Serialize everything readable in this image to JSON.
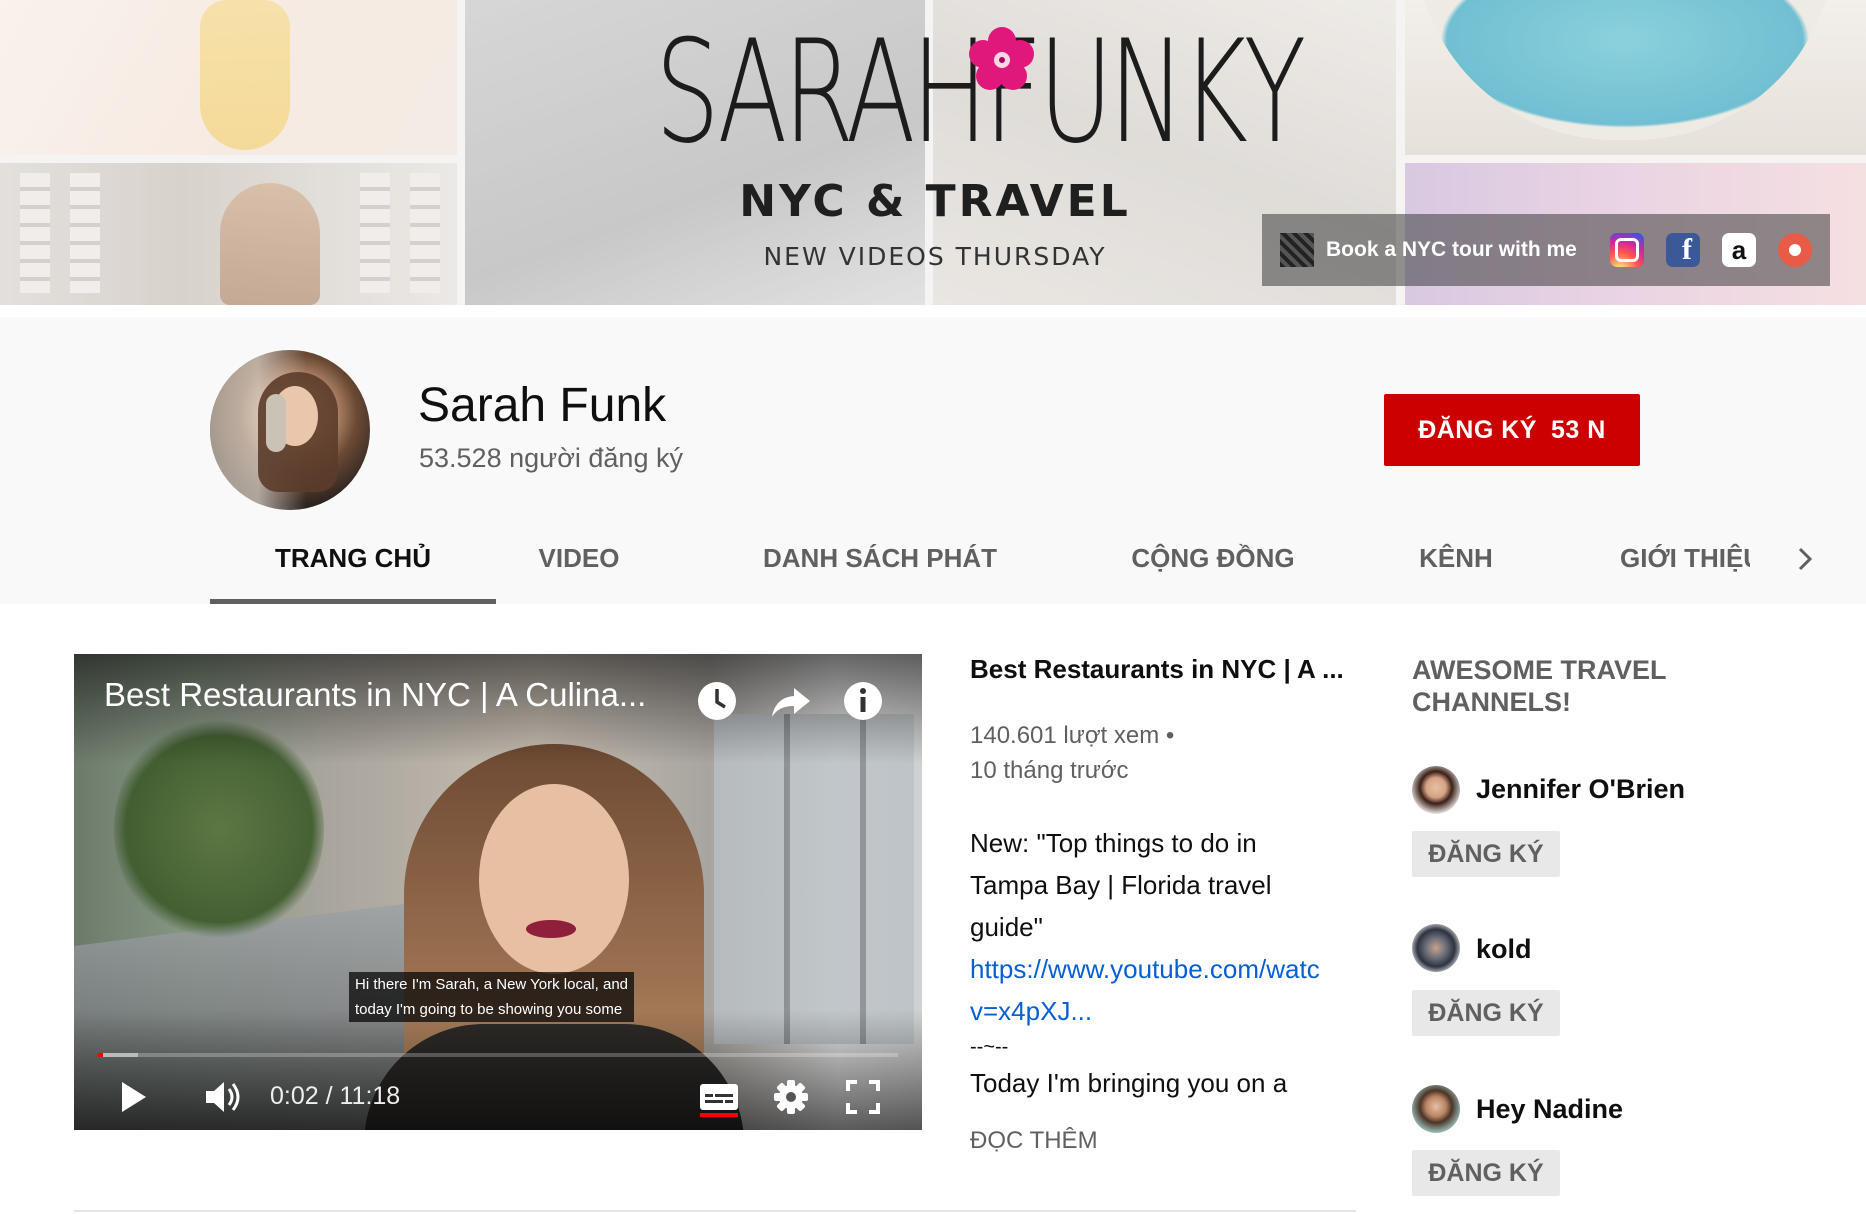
{
  "banner": {
    "logo_title": "SARAHFUNKY",
    "logo_subtitle": "NYC & TRAVEL",
    "logo_tagline": "NEW VIDEOS THURSDAY",
    "links": {
      "primary_label": "Book a NYC tour with me",
      "icons": [
        "instagram-icon",
        "facebook-icon",
        "amazon-icon",
        "patreon-icon"
      ]
    }
  },
  "channel": {
    "name": "Sarah Funk",
    "subscribers": "53.528 người đăng ký",
    "subscribe_label": "ĐĂNG KÝ",
    "subscribe_count": "53 N"
  },
  "tabs": {
    "items": [
      {
        "label": "TRANG CHỦ",
        "active": true
      },
      {
        "label": "VIDEO",
        "active": false
      },
      {
        "label": "DANH SÁCH PHÁT",
        "active": false
      },
      {
        "label": "CỘNG ĐỒNG",
        "active": false
      },
      {
        "label": "KÊNH",
        "active": false
      },
      {
        "label": "GIỚI THIỆU",
        "active": false
      }
    ],
    "next_icon": "chevron-right-icon"
  },
  "player": {
    "title": "Best Restaurants in NYC | A Culina...",
    "caption_line1": "Hi there I'm Sarah, a New York local, and",
    "caption_line2": "today I'm going to be showing you some",
    "time": "0:02 / 11:18",
    "progress_played_fraction": 0.003,
    "progress_loaded_fraction": 0.05,
    "overlay_icons": [
      "watch-later-icon",
      "share-icon",
      "info-icon"
    ],
    "control_icons": [
      "play-icon",
      "volume-icon",
      "captions-icon",
      "settings-icon",
      "fullscreen-icon"
    ]
  },
  "video_info": {
    "title": "Best Restaurants in NYC | A ...",
    "views": "140.601 lượt xem •",
    "age": "10 tháng trước",
    "desc_line1": "New: \"Top things to do in",
    "desc_line2": "Tampa Bay | Florida travel",
    "desc_line3": "guide\"",
    "link_line1": "https://www.youtube.com/watc",
    "link_line2": "v=x4pXJ...",
    "separator": "--~--",
    "desc_line4": "Today I'm bringing you on a",
    "read_more": "ĐỌC THÊM"
  },
  "featured_channels": {
    "heading": "AWESOME TRAVEL CHANNELS!",
    "items": [
      {
        "name": "Jennifer O'Brien",
        "button": "ĐĂNG KÝ"
      },
      {
        "name": "kold",
        "button": "ĐĂNG KÝ"
      },
      {
        "name": "Hey Nadine",
        "button": "ĐĂNG KÝ"
      }
    ]
  },
  "colors": {
    "subscribe_red": "#cc0000",
    "link_blue": "#065fd4",
    "progress_red": "#ff0000",
    "hibiscus_pink": "#e0187c"
  }
}
